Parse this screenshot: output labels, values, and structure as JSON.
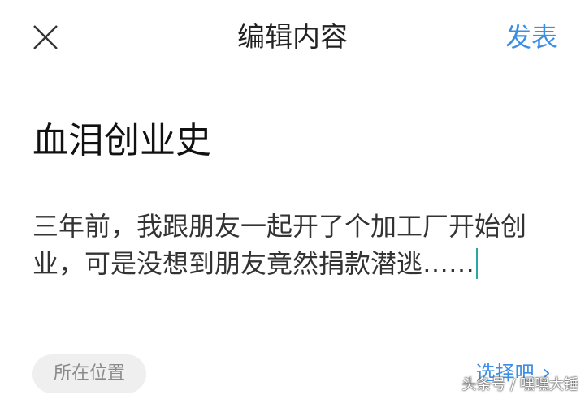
{
  "header": {
    "title": "编辑内容",
    "close_icon": "close-icon",
    "publish_label": "发表",
    "accent_color": "#3a8ee6"
  },
  "article": {
    "title": "血泪创业史",
    "body": "三年前，我跟朋友一起开了个加工厂开始创业，可是没想到朋友竟然捐款潜逃……"
  },
  "footer": {
    "location_label": "所在位置",
    "choose_label": "选择吧",
    "choose_icon": "chevron-right-icon"
  },
  "watermark": {
    "text": "头条号 / 嘿嘿大锤"
  }
}
